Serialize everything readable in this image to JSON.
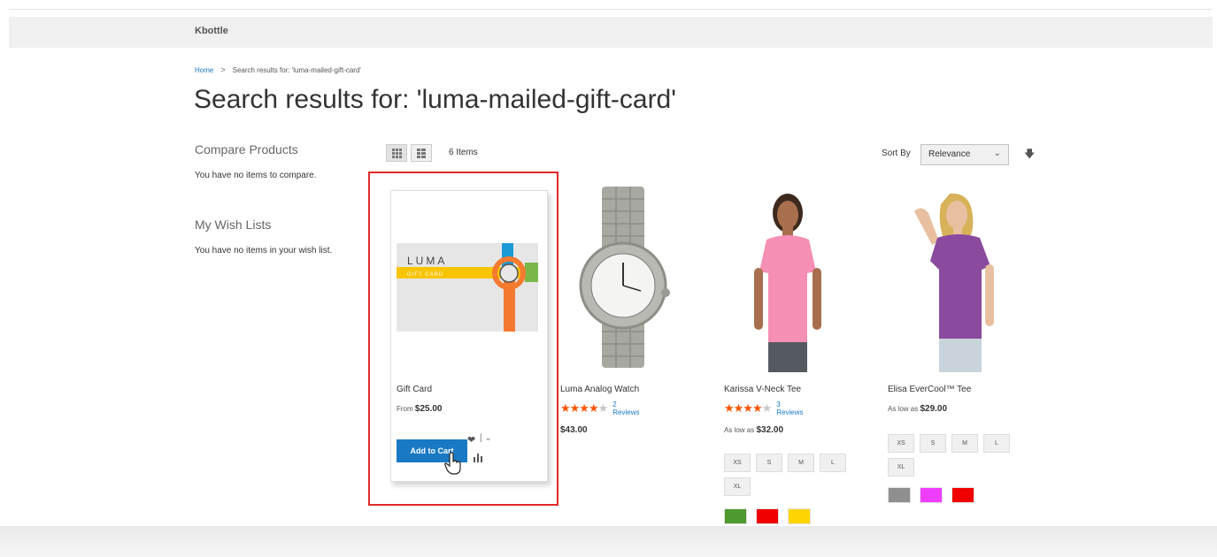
{
  "header": {
    "brand": "Kbottle"
  },
  "breadcrumb": {
    "home": "Home",
    "separator": ">",
    "current": "Search results for: 'luma-mailed-gift-card'"
  },
  "page_title": "Search results for: 'luma-mailed-gift-card'",
  "sidebar": {
    "compare_title": "Compare Products",
    "compare_text": "You have no items to compare.",
    "wishlist_title": "My Wish Lists",
    "wishlist_text": "You have no items in your wish list."
  },
  "toolbar": {
    "amount": "6 Items",
    "sort_label": "Sort By",
    "sort_value": "Relevance"
  },
  "products": [
    {
      "name": "Gift Card",
      "price_prefix": "From",
      "price": "$25.00",
      "add_to_cart": "Add to Cart",
      "logo_text": "LUMA",
      "logo_subtext": "GIFT CARD"
    },
    {
      "name": "Luma Analog Watch",
      "rating_pct": 70,
      "reviews": "2  Reviews",
      "price": "$43.00"
    },
    {
      "name": "Karissa V-Neck Tee",
      "rating_pct": 80,
      "reviews": "3  Reviews",
      "price_prefix": "As low as",
      "price": "$32.00",
      "sizes": [
        "XS",
        "S",
        "M",
        "L",
        "XL"
      ],
      "colors": [
        "#4e9a2e",
        "#f00000",
        "#ffd500"
      ]
    },
    {
      "name": "Elisa EverCool™ Tee",
      "price_prefix": "As low as",
      "price": "$29.00",
      "sizes": [
        "XS",
        "S",
        "M",
        "L",
        "XL"
      ],
      "colors": [
        "#8f8f8f",
        "#ef3dff",
        "#f00000"
      ]
    }
  ],
  "colors": {
    "accent": "#1979c3",
    "highlight": "#e02b27",
    "star": "#ff5501"
  }
}
